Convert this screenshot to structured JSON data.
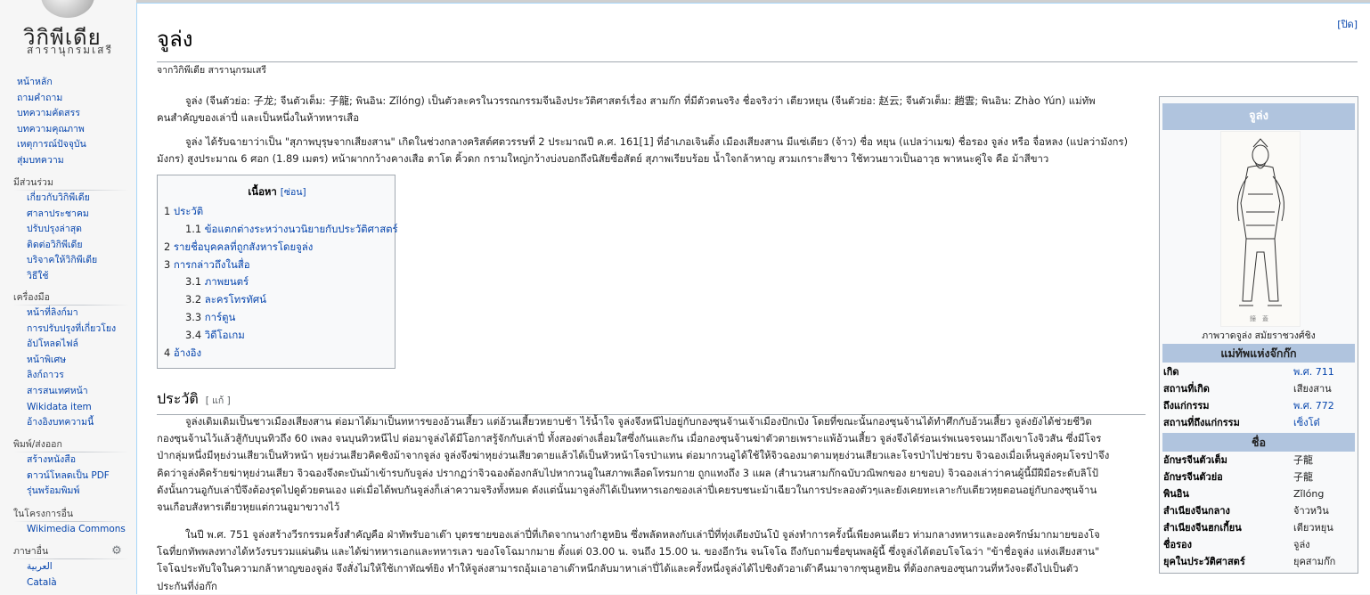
{
  "site": {
    "logo_name": "วิกิพีเดีย",
    "logo_tagline": "สารานุกรมเสรี"
  },
  "nav": {
    "main": [
      "หน้าหลัก",
      "ถามคำถาม",
      "บทความคัดสรร",
      "บทความคุณภาพ",
      "เหตุการณ์ปัจจุบัน",
      "สุ่มบทความ"
    ],
    "participate": {
      "header": "มีส่วนร่วม",
      "items": [
        "เกี่ยวกับวิกิพีเดีย",
        "ศาลาประชาคม",
        "ปรับปรุงล่าสุด",
        "ติดต่อวิกิพีเดีย",
        "บริจาคให้วิกิพีเดีย",
        "วิธีใช้"
      ]
    },
    "tools": {
      "header": "เครื่องมือ",
      "items": [
        "หน้าที่ลิงก์มา",
        "การปรับปรุงที่เกี่ยวโยง",
        "อัปโหลดไฟล์",
        "หน้าพิเศษ",
        "ลิงก์ถาวร",
        "สารสนเทศหน้า",
        "Wikidata item",
        "อ้างอิงบทความนี้"
      ]
    },
    "print": {
      "header": "พิมพ์/ส่งออก",
      "items": [
        "สร้างหนังสือ",
        "ดาวน์โหลดเป็น PDF",
        "รุ่นพร้อมพิมพ์"
      ]
    },
    "projects": {
      "header": "ในโครงการอื่น",
      "items": [
        "Wikimedia Commons"
      ]
    },
    "languages": {
      "header": "ภาษาอื่น",
      "items": [
        "العربية",
        "Català"
      ]
    }
  },
  "page": {
    "close_label": "[ปิด]",
    "title": "จูล่ง",
    "site_sub": "จากวิกิพีเดีย สารานุกรมเสรี",
    "intro1_line1": "จูล่ง (จีนตัวย่อ: 子龙; จีนตัวเต็ม: 子龍; พินอิน: Zǐlóng) เป็นตัวละครในวรรณกรรมจีนอิงประวัติศาสตร์เรื่อง สามก๊ก ที่มีตัวตนจริง ชื่อจริงว่า เตียวหยุน (จีนตัวย่อ: 赵云; จีนตัวเต็ม: 趙雲; พินอิน: Zhào Yún) แม่ทัพ",
    "intro1_line2": "คนสำคัญของเล่าปี่ และเป็นหนึ่งในห้าทหารเสือ",
    "intro2_line1": "จูล่ง ได้รับฉายาว่าเป็น \"สุภาพบุรุษจากเสียงสาน\" เกิดในช่วงกลางคริสต์ศตวรรษที่ 2 ประมาณปี ค.ศ. 161[1] ที่อำเภอเจินติ้ง เมืองเสียงสาน มีแซ่เตียว (จ้าว) ชื่อ หยุน (แปลว่าเมฆ) ชื่อรอง จูล่ง หรือ จื่อหลง (แปลว่ามังกร)",
    "intro2_line2": "มังกร) สูงประมาณ 6 ศอก (1.89 เมตร) หน้าผากกว้างคางเสือ ตาโต คิ้วดก กรามใหญ่กว้างบ่งบอกถึงนิสัยซื่อสัตย์ สุภาพเรียบร้อย น้ำใจกล้าหาญ สวมเกราะสีขาว ใช้ทวนยาวเป็นอาวุธ พาหนะคู่ใจ คือ ม้าสีขาว"
  },
  "toc": {
    "title": "เนื้อหา",
    "toggle": "[ซ่อน]",
    "items": [
      {
        "num": "1",
        "label": "ประวัติ"
      },
      {
        "num": "1.1",
        "label": "ข้อแตกต่างระหว่างนวนิยายกับประวัติศาสตร์"
      },
      {
        "num": "2",
        "label": "รายชื่อบุคคลที่ถูกสังหารโดยจูล่ง"
      },
      {
        "num": "3",
        "label": "การกล่าวถึงในสื่อ"
      },
      {
        "num": "3.1",
        "label": "ภาพยนตร์"
      },
      {
        "num": "3.2",
        "label": "ละครโทรทัศน์"
      },
      {
        "num": "3.3",
        "label": "การ์ตูน"
      },
      {
        "num": "3.4",
        "label": "วิดีโอเกม"
      },
      {
        "num": "4",
        "label": "อ้างอิง"
      }
    ]
  },
  "history": {
    "heading": "ประวัติ",
    "edit": "[ แก้ ]",
    "lines": [
      "จูล่งเดิมเดิมเป็นชาวเมืองเสียงสาน ต่อมาได้มาเป็นทหารของอ้วนเสี้ยว แต่อ้วนเสี้ยวหยาบช้า ไร้น้ำใจ จูล่งจึงหนีไปอยู่กับกองซุนจ้านเจ้าเมืองปักเป๋ง โดยที่ขณะนั้นกองซุนจ้านได้ทำศึกกับอ้วนเสี้ยว จูล่งยังได้ช่วยชีวิต",
      "กองซุนจ้านไว้แล้วสู้กับบุนทิวถึง 60 เพลง จนบุนทิวหนีไป ต่อมาจูล่งได้มีโอกาสรู้จักกับเล่าปี่ ทั้งสองต่างเลื่อมใสซึ่งกันและกัน เมื่อกองซุนจ้านฆ่าตัวตายเพราะแพ้อ้วนเสี้ยว จูล่งจึงได้ร่อนเร่พเนจรจนมาถึงเขาโงจิวสัน ซึ่งมีโจร",
      "ป่ากลุ่มหนึ่งมีหุยง่วนเสียวเป็นหัวหน้า หุยง่วนเสียวคิดชิงม้าจากจูล่ง จูล่งจึงฆ่าหุยง่วนเสียวตายแล้วได้เป็นหัวหน้าโจรป่าแทน ต่อมากวนอูได้ใช้ให้จิวฉองมาตามหุยง่วนเสียวและโจรป่าไปช่วยรบ จิวฉองเมื่อเห็นจูล่งคุมโจรป่าจึง",
      "คิดว่าจูล่งคิดร้ายฆ่าหุยง่วนเสียว จิวฉองจึงตะบันม้าเข้ารบกับจูล่ง ปรากฏว่าจิวฉองต้องกลับไปหากวนอูในสภาพเลือดโทรมกาย ถูกแทงถึง 3 แผล (สำนวนสามก๊กฉบับวณิพกของ ยาขอบ) จิวฉองเล่าว่าคนผู้นี้มีฝีมือระดับลิโป้",
      "ดังนั้นกวนอูกับเล่าปี่จึงต้องรุดไปดูด้วยตนเอง แต่เมื่อได้พบกันจูล่งก็เล่าความจริงทั้งหมด ดังแต่นั้นมาจูล่งก็ได้เป็นทหารเอกของเล่าปี่เคยรบชนะม้าเฉียวในการประลองตัวๆและยังเคยทะเลาะกับเตียวหุยตอนอยู่กับกองซุนจ้าน",
      "จนเกือบสังหารเตียวหุยแต่กวนอูมาขวางไว้"
    ],
    "p2_lines": [
      "ในปี พ.ศ. 751 จูล่งสร้างวีรกรรมครั้งสำคัญคือ ฝ่าทัพรับอาเต๊า บุตรชายของเล่าปี่ที่เกิดจากนางกำฮูหยิน ซึ่งพลัดหลงกับเล่าปี่ที่ทุ่งเตียงบันโป๋ จูล่งทำการครั้งนี้เพียงคนเดียว ท่ามกลางทหารและองครักษ์มากมายของโจ",
      "โฉที่ยกทัพพลงทางได้หวังรบรวมแผ่นดิน และได้ฆ่าทหารเอกและทหารเลว ของโจโฉมากมาย ตั้งแต่ 03.00 น. จนถึง 15.00 น. ของอีกวัน จนโจโฉ ถึงกับถามชื่อขุนพลผู้นี้ ซึ่งจูล่งได้ตอบโจโฉว่า \"ข้าชื่อจูล่ง แห่งเสียงสาน\"",
      "โจโฉประทับใจในความกล้าหาญของจูล่ง จึงสั่งไม่ให้ใช้เกาทัณฑ์ยิง ทำให้จูล่งสามารถอุ้มเอาอาเต๊าหนีกลับมาหาเล่าปี่ได้และครั้งหนึ่งจูล่งได้ไปชิงตัวอาเต๊าคืนมาจากซุนฮูหยิน ที่ต้องกลของซุนกวนที่หวังจะดึงไปเป็นตัว",
      "ประกันที่ง่อก๊ก"
    ]
  },
  "infobox": {
    "title": "จูล่ง",
    "caption": "ภาพวาดจูล่ง สมัยราชวงศ์ชิง",
    "sec1": "แม่ทัพแห่งจ๊กก๊ก",
    "rows1": [
      {
        "k": "เกิด",
        "v": "พ.ศ. 711"
      },
      {
        "k": "สถานที่เกิด",
        "v": "เสียงสาน"
      },
      {
        "k": "ถึงแก่กรรม",
        "v": "พ.ศ. 772"
      },
      {
        "k": "สถานที่ถึงแก่กรรม",
        "v": "เซ็งโต๋"
      }
    ],
    "sec2": "ชื่อ",
    "rows2": [
      {
        "k": "อักษรจีนตัวเต็ม",
        "v": "子龍"
      },
      {
        "k": "อักษรจีนตัวย่อ",
        "v": "子龍"
      },
      {
        "k": "พินอิน",
        "v": "Zǐlóng"
      },
      {
        "k": "สำเนียงจีนกลาง",
        "v": "จ้าวหวิน"
      },
      {
        "k": "สำเนียงจีนฮกเกี้ยน",
        "v": "เตียวหยุน"
      },
      {
        "k": "ชื่อรอง",
        "v": "จูล่ง"
      },
      {
        "k": "ยุคในประวัติศาสตร์",
        "v": "ยุคสามก๊ก"
      }
    ]
  }
}
